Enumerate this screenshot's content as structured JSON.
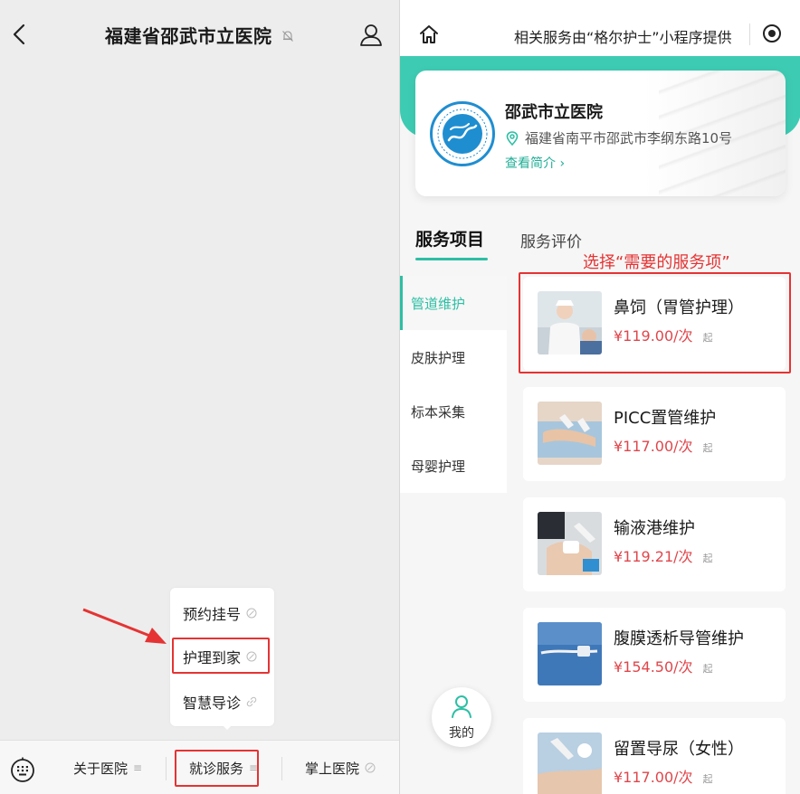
{
  "left": {
    "title": "福建省邵武市立医院",
    "popup": {
      "items": [
        "预约挂号",
        "护理到家",
        "智慧导诊"
      ]
    },
    "bottom_tabs": {
      "t1": "关于医院",
      "t2": "就诊服务",
      "t3": "掌上医院"
    }
  },
  "right": {
    "topbar_text": "相关服务由“格尔护士”小程序提供",
    "hospital": {
      "name": "邵武市立医院",
      "address": "福建省南平市邵武市李纲东路10号",
      "more": "查看简介"
    },
    "tabs": {
      "services": "服务项目",
      "reviews": "服务评价"
    },
    "annotation": "选择“需要的服务项”",
    "categories": [
      "管道维护",
      "皮肤护理",
      "标本采集",
      "母婴护理"
    ],
    "services": [
      {
        "name": "鼻饲（胃管护理）",
        "price": "¥119.00/次",
        "suffix": "起"
      },
      {
        "name": "PICC置管维护",
        "price": "¥117.00/次",
        "suffix": "起"
      },
      {
        "name": "输液港维护",
        "price": "¥119.21/次",
        "suffix": "起"
      },
      {
        "name": "腹膜透析导管维护",
        "price": "¥154.50/次",
        "suffix": "起"
      },
      {
        "name": "留置导尿（女性）",
        "price": "¥117.00/次",
        "suffix": "起"
      }
    ],
    "me_label": "我的"
  },
  "colors": {
    "accent_teal": "#3ecbb3",
    "price_red": "#e0464b",
    "highlight_red": "#e53333"
  }
}
